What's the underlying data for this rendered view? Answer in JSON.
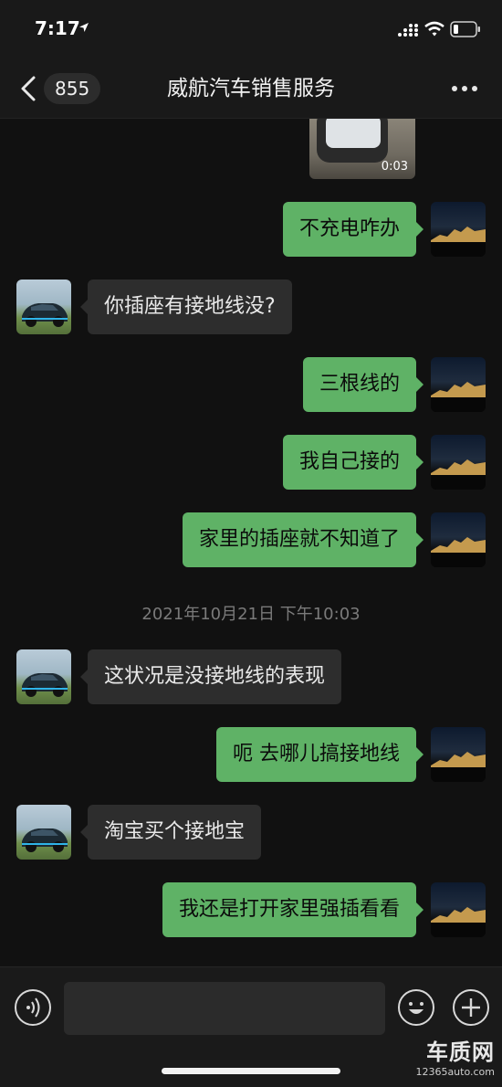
{
  "status_bar": {
    "time": "7:17",
    "icons": [
      "location-arrow-icon",
      "signal-icon",
      "wifi-icon",
      "battery-icon"
    ]
  },
  "nav": {
    "back_icon": "chevron-left-icon",
    "unread_count": "855",
    "title": "威航汽车销售服务",
    "more_icon": "ellipsis-icon"
  },
  "chat": {
    "video": {
      "duration": "0:03"
    },
    "timestamp": "2021年10月21日 下午10:03",
    "messages": [
      {
        "direction": "out",
        "text": "不充电咋办"
      },
      {
        "direction": "in",
        "text": "你插座有接地线没?"
      },
      {
        "direction": "out",
        "text": "三根线的"
      },
      {
        "direction": "out",
        "text": "我自己接的"
      },
      {
        "direction": "out",
        "text": "家里的插座就不知道了"
      },
      {
        "direction": "in",
        "text": "这状况是没接地线的表现"
      },
      {
        "direction": "out",
        "text": "呃 去哪儿搞接地线"
      },
      {
        "direction": "in",
        "text": "淘宝买个接地宝"
      },
      {
        "direction": "out",
        "text": "我还是打开家里强插看看"
      }
    ]
  },
  "input_bar": {
    "voice_icon": "voice-icon",
    "input_value": "",
    "emoji_icon": "emoji-icon",
    "plus_icon": "plus-icon"
  },
  "watermark": {
    "logo": "车质网",
    "url": "12365auto.com"
  },
  "colors": {
    "background": "#111111",
    "outgoing_bubble": "#5fb266",
    "incoming_bubble": "#2d2d2d",
    "bar": "#191919"
  }
}
